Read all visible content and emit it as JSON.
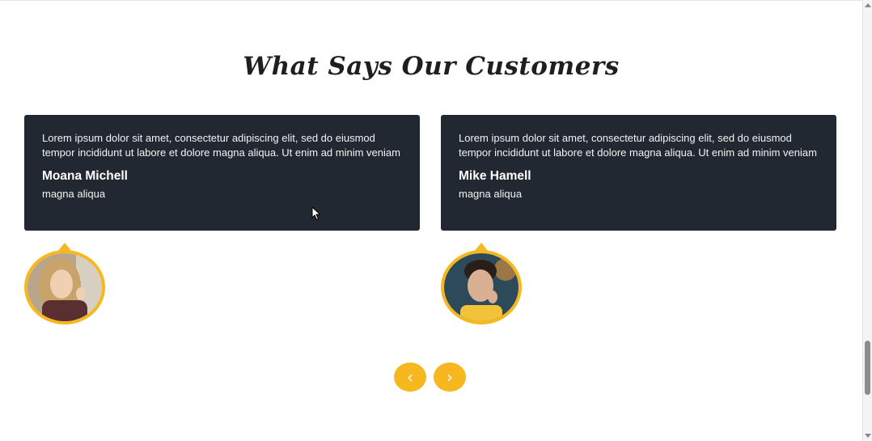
{
  "section": {
    "title": "What Says Our Customers"
  },
  "testimonials": [
    {
      "quote": "Lorem ipsum dolor sit amet, consectetur adipiscing elit, sed do eiusmod tempor incididunt ut labore et dolore magna aliqua. Ut enim ad minim veniam",
      "name": "Moana Michell",
      "role": "magna aliqua"
    },
    {
      "quote": "Lorem ipsum dolor sit amet, consectetur adipiscing elit, sed do eiusmod tempor incididunt ut labore et dolore magna aliqua. Ut enim ad minim veniam",
      "name": "Mike Hamell",
      "role": "magna aliqua"
    }
  ],
  "nav": {
    "prev_icon": "‹",
    "next_icon": "›"
  },
  "colors": {
    "accent": "#f7b71e",
    "card_bg": "#222831",
    "title": "#1f1f1f"
  },
  "icons": {
    "prev": "chevron-left-icon",
    "next": "chevron-right-icon",
    "cursor": "mouse-pointer-icon"
  }
}
